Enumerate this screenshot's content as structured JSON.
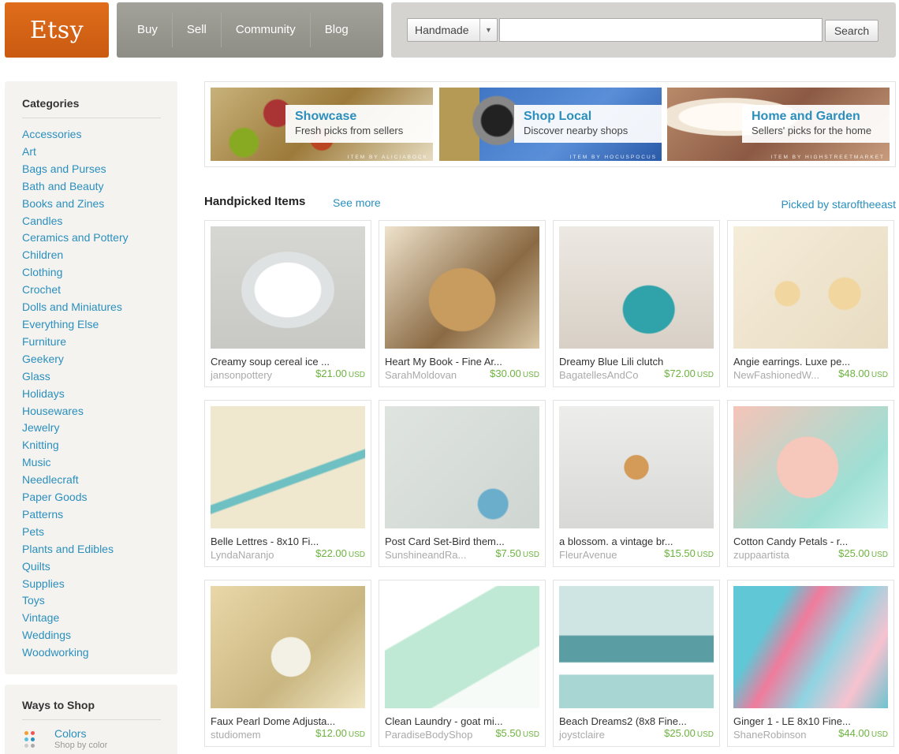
{
  "header": {
    "logo": "Etsy",
    "nav": [
      "Buy",
      "Sell",
      "Community",
      "Blog"
    ],
    "search": {
      "category": "Handmade",
      "placeholder": "",
      "button": "Search"
    }
  },
  "sidebar": {
    "categories_title": "Categories",
    "categories": [
      "Accessories",
      "Art",
      "Bags and Purses",
      "Bath and Beauty",
      "Books and Zines",
      "Candles",
      "Ceramics and Pottery",
      "Children",
      "Clothing",
      "Crochet",
      "Dolls and Miniatures",
      "Everything Else",
      "Furniture",
      "Geekery",
      "Glass",
      "Holidays",
      "Housewares",
      "Jewelry",
      "Knitting",
      "Music",
      "Needlecraft",
      "Paper Goods",
      "Patterns",
      "Pets",
      "Plants and Edibles",
      "Quilts",
      "Supplies",
      "Toys",
      "Vintage",
      "Weddings",
      "Woodworking"
    ],
    "ways_title": "Ways to Shop",
    "ways": [
      {
        "title": "Colors",
        "subtitle": "Shop by color",
        "icon": "color-dots-icon"
      }
    ]
  },
  "promos": [
    {
      "title": "Showcase",
      "subtitle": "Fresh picks from sellers",
      "credit": "ITEM BY ALICIABOCK"
    },
    {
      "title": "Shop Local",
      "subtitle": "Discover nearby shops",
      "credit": "ITEM BY HOCUSPOCUS"
    },
    {
      "title": "Home and Garden",
      "subtitle": "Sellers' picks for the home",
      "credit": "ITEM BY HIGHSTREETMARKET"
    }
  ],
  "handpicked": {
    "title": "Handpicked Items",
    "see_more": "See more",
    "picked_by": "Picked by staroftheeast",
    "currency": "USD",
    "items": [
      {
        "name": "Creamy soup cereal ice ...",
        "shop": "jansonpottery",
        "price": "$21.00"
      },
      {
        "name": "Heart My Book - Fine Ar...",
        "shop": "SarahMoldovan",
        "price": "$30.00"
      },
      {
        "name": "Dreamy Blue Lili clutch",
        "shop": "BagatellesAndCo",
        "price": "$72.00"
      },
      {
        "name": "Angie earrings. Luxe pe...",
        "shop": "NewFashionedW...",
        "price": "$48.00"
      },
      {
        "name": "Belle Lettres - 8x10 Fi...",
        "shop": "LyndaNaranjo",
        "price": "$22.00"
      },
      {
        "name": "Post Card Set-Bird them...",
        "shop": "SunshineandRa...",
        "price": "$7.50"
      },
      {
        "name": "a blossom. a vintage br...",
        "shop": "FleurAvenue",
        "price": "$15.50"
      },
      {
        "name": "Cotton Candy Petals - r...",
        "shop": "zuppaartista",
        "price": "$25.00"
      },
      {
        "name": "Faux Pearl Dome Adjusta...",
        "shop": "studiomem",
        "price": "$12.00"
      },
      {
        "name": "Clean Laundry - goat mi...",
        "shop": "ParadiseBodyShop",
        "price": "$5.50"
      },
      {
        "name": "Beach Dreams2 (8x8 Fine...",
        "shop": "joystclaire",
        "price": "$25.00"
      },
      {
        "name": "Ginger 1 - LE 8x10 Fine...",
        "shop": "ShaneRobinson",
        "price": "$44.00"
      }
    ]
  }
}
